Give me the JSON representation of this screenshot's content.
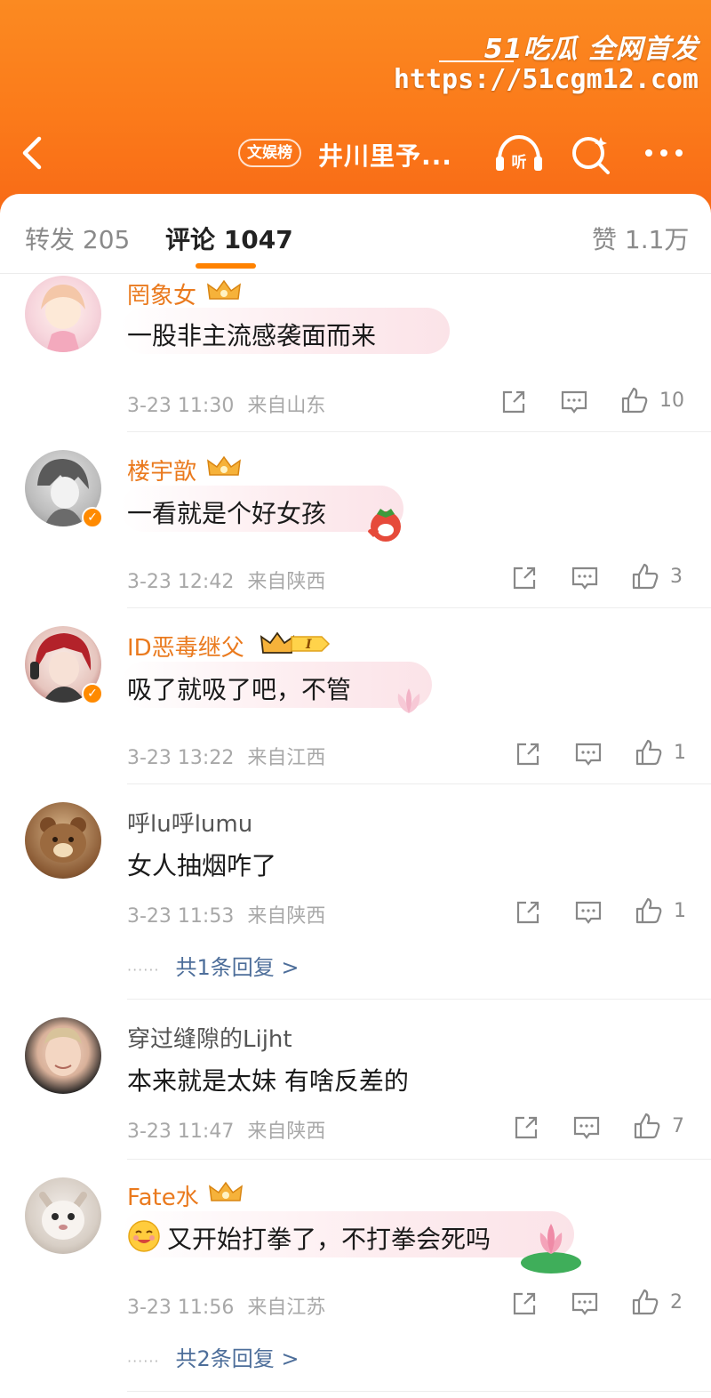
{
  "header": {
    "topic_badge": "文娱榜",
    "title": "井川里予...",
    "accent": "#fb7a1a"
  },
  "watermark": {
    "brand": "51吃瓜 全网首发",
    "url": "https://51cgm12.com"
  },
  "tabs": {
    "repost": "转发 205",
    "comments": "评论 1047",
    "likes": "赞 1.1万"
  },
  "comments": [
    {
      "user": "罔象女",
      "text": "一股非主流感袭面而来",
      "time": "3-23 11:30",
      "location": "来自山东",
      "likes": "10",
      "vip": true
    },
    {
      "user": "楼宇歆",
      "text": "一看就是个好女孩",
      "time": "3-23 12:42",
      "location": "来自陕西",
      "likes": "3",
      "vip": true
    },
    {
      "user": "ID恶毒继父",
      "text": "吸了就吸了吧，不管",
      "time": "3-23 13:22",
      "location": "来自江西",
      "likes": "1",
      "vip": true
    },
    {
      "user": "呼lu呼lumu",
      "text": "女人抽烟咋了",
      "time": "3-23 11:53",
      "location": "来自陕西",
      "likes": "1",
      "reply": "共1条回复 >"
    },
    {
      "user": "穿过缝隙的Lijht",
      "text": "本来就是太妹  有啥反差的",
      "time": "3-23 11:47",
      "location": "来自陕西",
      "likes": "7"
    },
    {
      "user": "Fate水",
      "text": "又开始打拳了，不打拳会死吗",
      "time": "3-23 11:56",
      "location": "来自江苏",
      "likes": "2",
      "vip": true,
      "reply": "共2条回复 >"
    }
  ],
  "reply_dots": "······",
  "icons": [
    "back-icon",
    "listen-icon",
    "search-icon",
    "more-icon",
    "share-icon",
    "comment-icon",
    "like-icon",
    "crown-icon",
    "verified-icon"
  ]
}
